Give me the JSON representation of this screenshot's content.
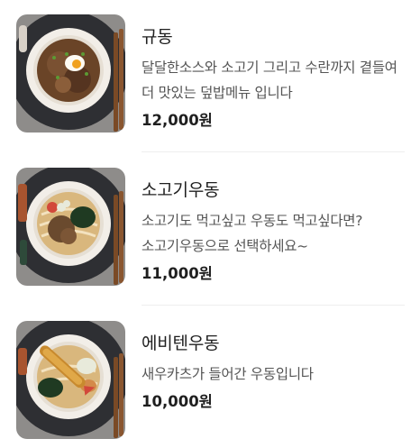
{
  "menu": {
    "items": [
      {
        "name": "규동",
        "description": "달달한소스와 소고기 그리고 수란까지 곁들여 더 맛있는 덮밥메뉴 입니다",
        "price": "12,000원",
        "image": "gyudon-bowl-photo"
      },
      {
        "name": "소고기우동",
        "description": "소고기도 먹고싶고 우동도 먹고싶다면? 소고기우동으로 선택하세요~",
        "price": "11,000원",
        "image": "beef-udon-bowl-photo"
      },
      {
        "name": "에비텐우동",
        "description": "새우카츠가 들어간 우동입니다",
        "price": "10,000원",
        "image": "ebiten-udon-bowl-photo"
      }
    ]
  }
}
